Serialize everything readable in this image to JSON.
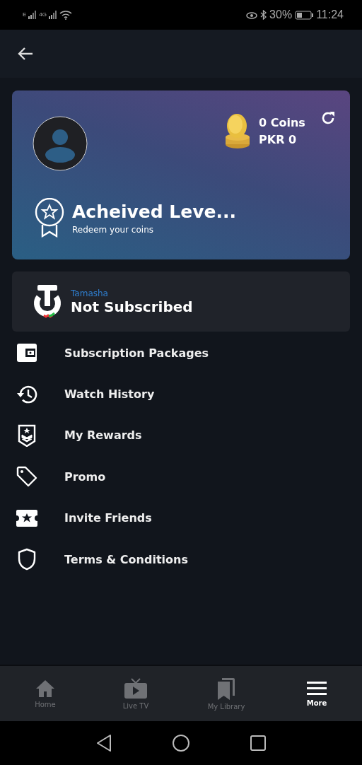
{
  "status_bar": {
    "network_1": "E",
    "network_2": "4G",
    "battery": "30%",
    "time": "11:24"
  },
  "profile_card": {
    "coins": "0 Coins",
    "balance": "PKR 0",
    "level_title": "Acheived Leve...",
    "level_subtitle": "Redeem your coins"
  },
  "subscription": {
    "provider": "Tamasha",
    "status": "Not Subscribed"
  },
  "menu": [
    {
      "kind": "wallet",
      "label": "Subscription Packages"
    },
    {
      "kind": "history",
      "label": "Watch History"
    },
    {
      "kind": "rewards",
      "label": "My Rewards"
    },
    {
      "kind": "tag",
      "label": "Promo"
    },
    {
      "kind": "ticket",
      "label": "Invite Friends"
    },
    {
      "kind": "shield",
      "label": "Terms & Conditions"
    }
  ],
  "bottom_nav": [
    {
      "kind": "home",
      "label": "Home",
      "selected": false
    },
    {
      "kind": "tv",
      "label": "Live TV",
      "selected": false
    },
    {
      "kind": "library",
      "label": "My Library",
      "selected": false
    },
    {
      "kind": "more",
      "label": "More",
      "selected": true
    }
  ]
}
